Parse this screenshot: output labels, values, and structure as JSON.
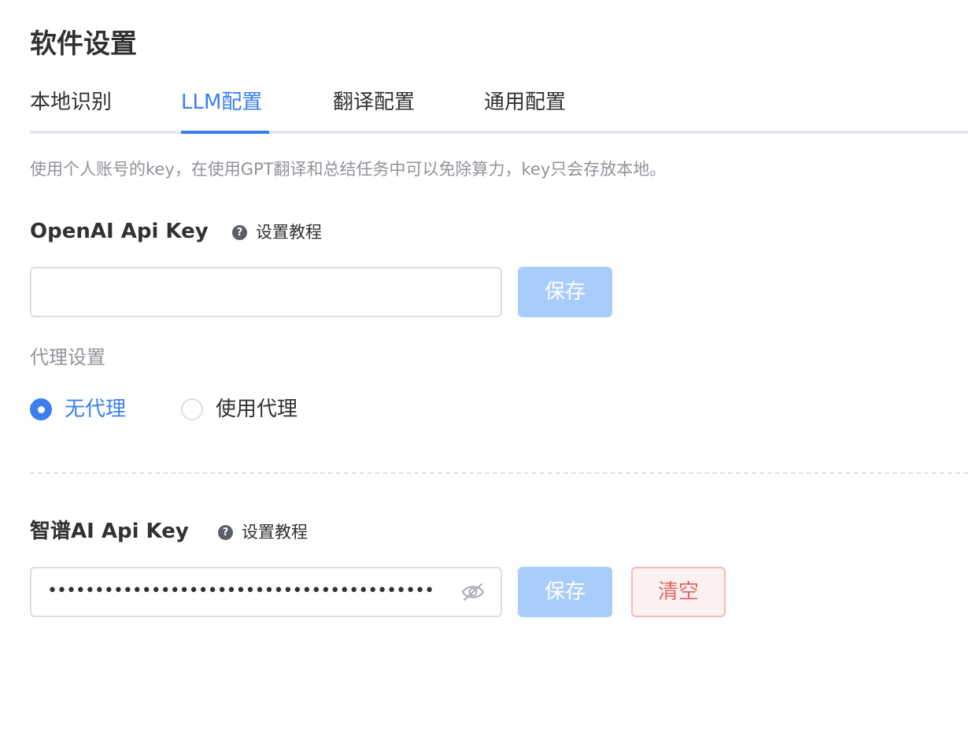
{
  "page": {
    "title": "软件设置"
  },
  "tabs": [
    {
      "label": "本地识别",
      "active": false
    },
    {
      "label": "LLM配置",
      "active": true
    },
    {
      "label": "翻译配置",
      "active": false
    },
    {
      "label": "通用配置",
      "active": false
    }
  ],
  "description": "使用个人账号的key，在使用GPT翻译和总结任务中可以免除算力，key只会存放本地。",
  "openai": {
    "label": "OpenAI Api Key",
    "help_label": "设置教程",
    "help_icon": "question-circle-icon",
    "value": "",
    "save_label": "保存"
  },
  "proxy": {
    "label": "代理设置",
    "options": [
      {
        "label": "无代理",
        "checked": true
      },
      {
        "label": "使用代理",
        "checked": false
      }
    ]
  },
  "zhipu": {
    "label": "智谱AI Api Key",
    "help_label": "设置教程",
    "help_icon": "question-circle-icon",
    "masked_value": "•••••••••••••••••••••••••••••••••••••••••••••••••",
    "eye_icon": "eye-off-icon",
    "save_label": "保存",
    "clear_label": "清空"
  },
  "colors": {
    "accent": "#3a7ef0",
    "primary_disabled": "#a9cdfa",
    "danger": "#e06666",
    "border": "#dcdfe6",
    "muted_text": "#909399"
  }
}
